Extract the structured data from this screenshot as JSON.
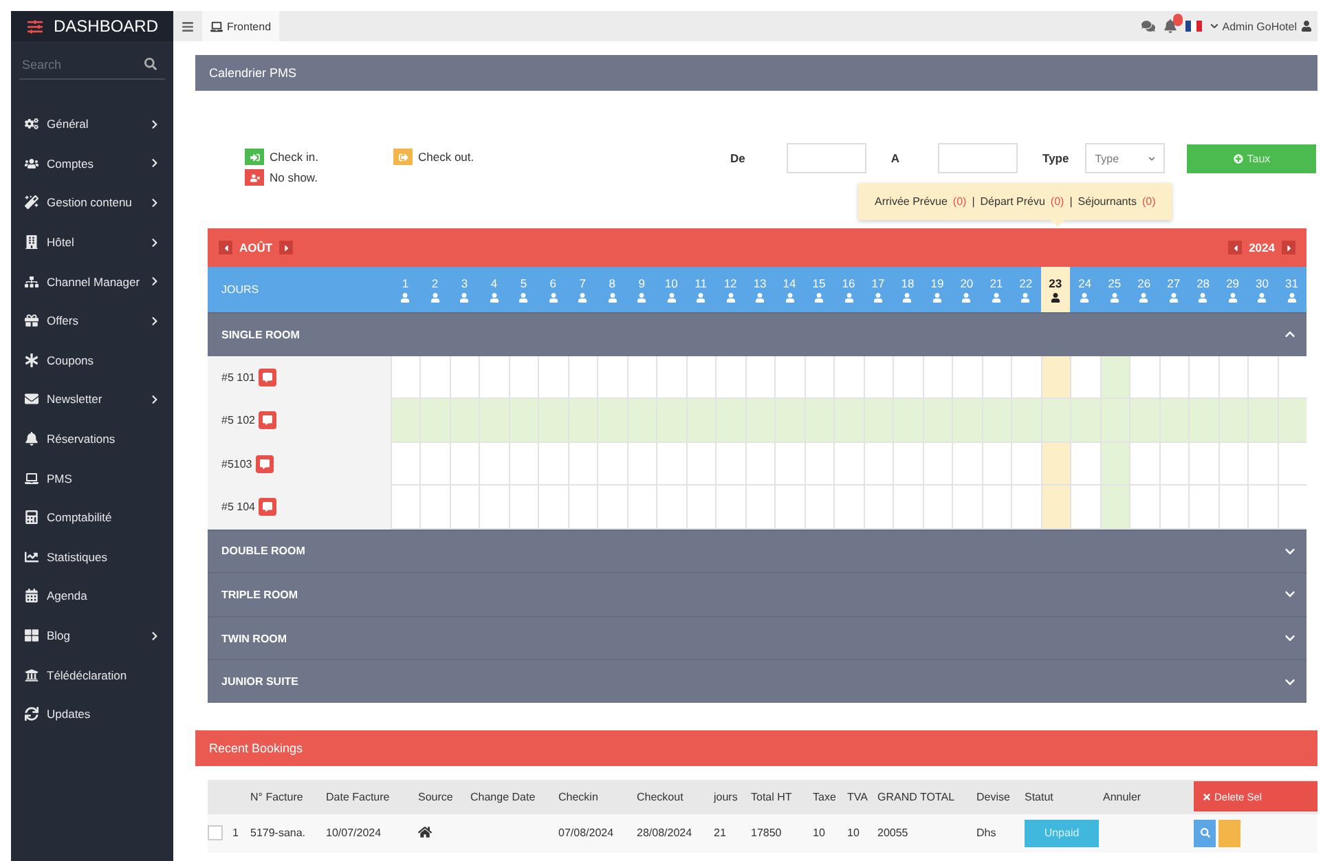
{
  "sidebar": {
    "brand": "DASHBOARD",
    "search": {
      "placeholder": "Search"
    },
    "items": [
      {
        "label": "Général",
        "has_submenu": true
      },
      {
        "label": "Comptes",
        "has_submenu": true
      },
      {
        "label": "Gestion contenu",
        "has_submenu": true
      },
      {
        "label": "Hôtel",
        "has_submenu": true
      },
      {
        "label": "Channel Manager",
        "has_submenu": true
      },
      {
        "label": "Offers",
        "has_submenu": true
      },
      {
        "label": "Coupons",
        "has_submenu": false
      },
      {
        "label": "Newsletter",
        "has_submenu": true
      },
      {
        "label": "Réservations",
        "has_submenu": false
      },
      {
        "label": "PMS",
        "has_submenu": false
      },
      {
        "label": "Comptabilité",
        "has_submenu": false
      },
      {
        "label": "Statistiques",
        "has_submenu": false
      },
      {
        "label": "Agenda",
        "has_submenu": false
      },
      {
        "label": "Blog",
        "has_submenu": true
      },
      {
        "label": "Télédéclaration",
        "has_submenu": false
      },
      {
        "label": "Updates",
        "has_submenu": false
      }
    ]
  },
  "topbar": {
    "tab": "Frontend",
    "user": "Admin GoHotel"
  },
  "calendar_panel": {
    "title": "Calendrier PMS",
    "legend": [
      {
        "kind": "checkin",
        "label": "Check in."
      },
      {
        "kind": "checkout",
        "label": "Check out."
      },
      {
        "kind": "noshow",
        "label": "No show."
      }
    ],
    "filters": {
      "from_label": "De",
      "to_label": "A",
      "type_label": "Type",
      "type_value": "Type",
      "button": "Taux"
    },
    "popover": {
      "separator": "|",
      "items": [
        {
          "label": "Arrivée Prévue",
          "count": "(0)"
        },
        {
          "label": "Départ Prévu",
          "count": "(0)"
        },
        {
          "label": "Séjournants",
          "count": "(0)"
        }
      ]
    },
    "month": "AOÛT",
    "year": "2024",
    "days_label": "JOURS",
    "days": [
      {
        "label": "1",
        "selected": false,
        "marked": false
      },
      {
        "label": "2",
        "selected": false,
        "marked": false
      },
      {
        "label": "3",
        "selected": false,
        "marked": false
      },
      {
        "label": "4",
        "selected": false,
        "marked": false
      },
      {
        "label": "5",
        "selected": false,
        "marked": false
      },
      {
        "label": "6",
        "selected": false,
        "marked": false
      },
      {
        "label": "7",
        "selected": false,
        "marked": false
      },
      {
        "label": "8",
        "selected": false,
        "marked": false
      },
      {
        "label": "9",
        "selected": false,
        "marked": false
      },
      {
        "label": "10",
        "selected": false,
        "marked": false
      },
      {
        "label": "11",
        "selected": false,
        "marked": false
      },
      {
        "label": "12",
        "selected": false,
        "marked": false
      },
      {
        "label": "13",
        "selected": false,
        "marked": false
      },
      {
        "label": "14",
        "selected": false,
        "marked": false
      },
      {
        "label": "15",
        "selected": false,
        "marked": false
      },
      {
        "label": "16",
        "selected": false,
        "marked": false
      },
      {
        "label": "17",
        "selected": false,
        "marked": false
      },
      {
        "label": "18",
        "selected": false,
        "marked": false
      },
      {
        "label": "19",
        "selected": false,
        "marked": false
      },
      {
        "label": "20",
        "selected": false,
        "marked": false
      },
      {
        "label": "21",
        "selected": false,
        "marked": false
      },
      {
        "label": "22",
        "selected": false,
        "marked": false
      },
      {
        "label": "23",
        "selected": true,
        "marked": false
      },
      {
        "label": "24",
        "selected": false,
        "marked": false
      },
      {
        "label": "25",
        "selected": false,
        "marked": true
      },
      {
        "label": "26",
        "selected": false,
        "marked": false
      },
      {
        "label": "27",
        "selected": false,
        "marked": false
      },
      {
        "label": "28",
        "selected": false,
        "marked": false
      },
      {
        "label": "29",
        "selected": false,
        "marked": false
      },
      {
        "label": "30",
        "selected": false,
        "marked": false
      },
      {
        "label": "31",
        "selected": false,
        "marked": false
      }
    ],
    "sections": [
      {
        "label": "SINGLE ROOM",
        "expanded": true,
        "rooms": [
          {
            "label": "#5 101",
            "highlighted": false
          },
          {
            "label": "#5 102",
            "highlighted": true
          },
          {
            "label": "#5103",
            "highlighted": false
          },
          {
            "label": "#5 104",
            "highlighted": false
          }
        ]
      },
      {
        "label": "DOUBLE ROOM",
        "expanded": false
      },
      {
        "label": "TRIPLE ROOM",
        "expanded": false
      },
      {
        "label": "TWIN ROOM",
        "expanded": false
      },
      {
        "label": "JUNIOR SUITE",
        "expanded": false
      }
    ]
  },
  "bookings": {
    "title": "Recent Bookings",
    "delete_button": "Delete Sel",
    "columns": [
      "N° Facture",
      "Date Facture",
      "Source",
      "Change Date",
      "Checkin",
      "Checkout",
      "jours",
      "Total HT",
      "Taxe",
      "TVA",
      "GRAND TOTAL",
      "Devise",
      "Statut",
      "Annuler"
    ],
    "rows": [
      {
        "checked": false,
        "index": "1",
        "cells": [
          {
            "kind": "text",
            "text": "5179-sana."
          },
          {
            "kind": "text",
            "text": "10/07/2024"
          },
          {
            "kind": "icon"
          },
          {
            "kind": "empty"
          },
          {
            "kind": "text",
            "text": "07/08/2024"
          },
          {
            "kind": "text",
            "text": "28/08/2024"
          },
          {
            "kind": "text",
            "text": "21"
          },
          {
            "kind": "text",
            "text": "17850"
          },
          {
            "kind": "text",
            "text": "10"
          },
          {
            "kind": "text",
            "text": "10"
          },
          {
            "kind": "text",
            "text": "20055"
          },
          {
            "kind": "text",
            "text": "Dhs"
          },
          {
            "kind": "status",
            "text": "Unpaid"
          },
          {
            "kind": "empty"
          }
        ]
      }
    ]
  }
}
